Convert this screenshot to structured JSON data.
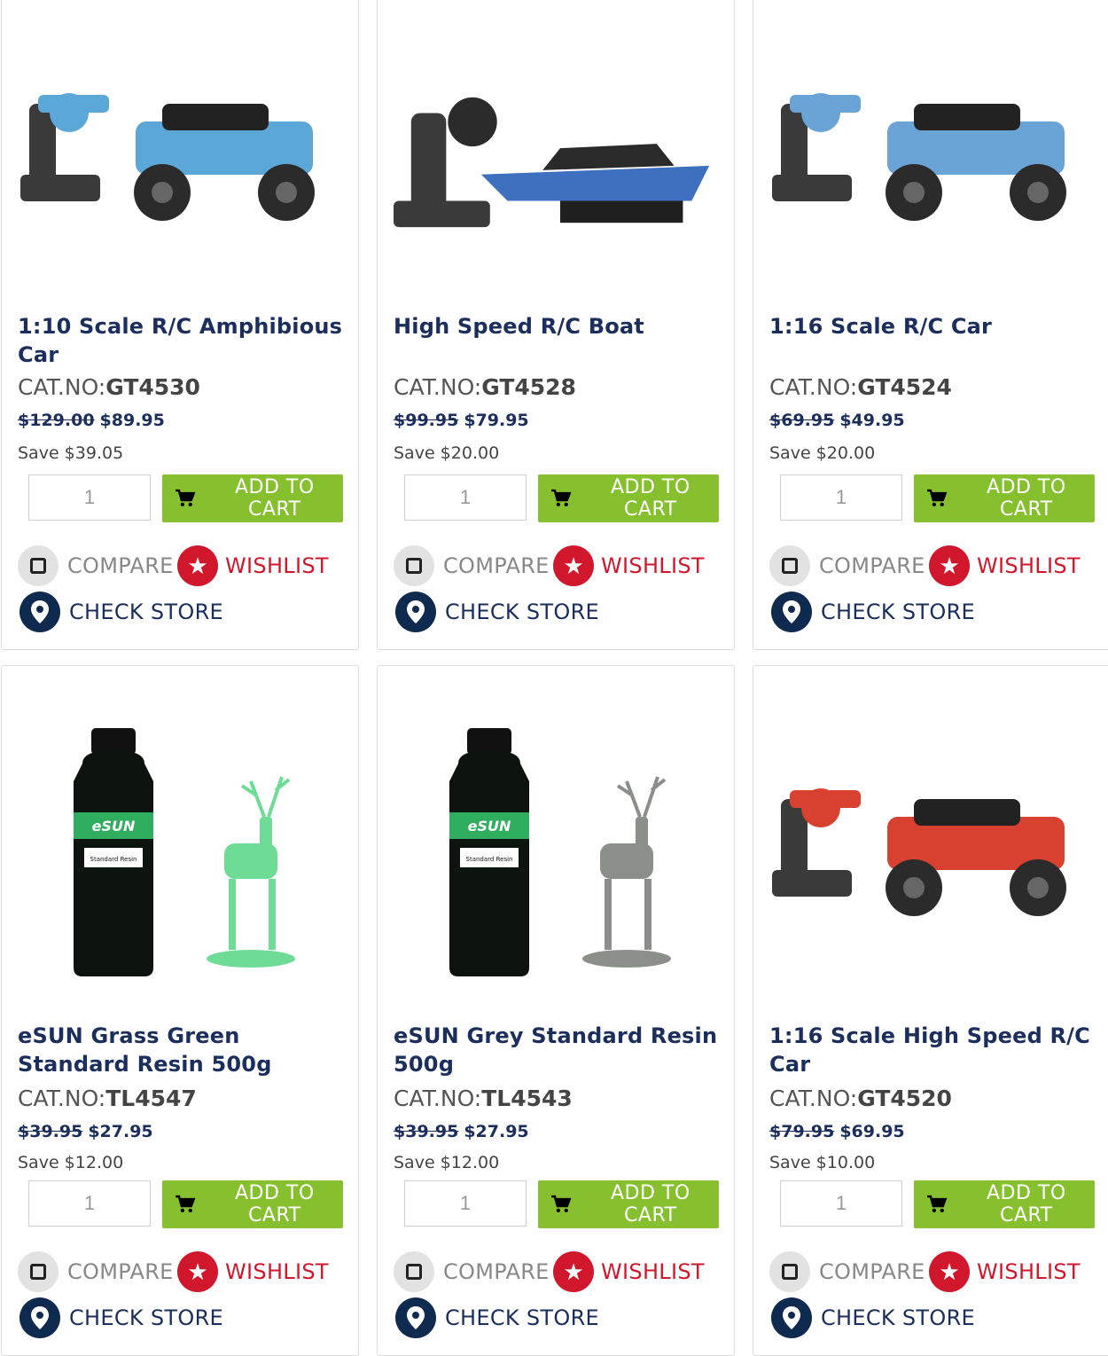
{
  "products": [
    {
      "title": "1:10 Scale R/C Amphibious Car",
      "catno_label": "CAT.NO:",
      "catno": "GT4530",
      "old_price": "$129.00",
      "price": "$89.95",
      "save": "Save $39.05",
      "qty": "1",
      "image": "rc-amphibious-car-blue",
      "accent": "#5aa7d8"
    },
    {
      "title": "High Speed R/C Boat",
      "catno_label": "CAT.NO:",
      "catno": "GT4528",
      "old_price": "$99.95",
      "price": "$79.95",
      "save": "Save $20.00",
      "qty": "1",
      "image": "rc-boat-blue",
      "accent": "#3f6fbf"
    },
    {
      "title": "1:16 Scale R/C Car",
      "catno_label": "CAT.NO:",
      "catno": "GT4524",
      "old_price": "$69.95",
      "price": "$49.95",
      "save": "Save $20.00",
      "qty": "1",
      "image": "rc-car-blue",
      "accent": "#6aa3d6"
    },
    {
      "title": "eSUN Grass Green Standard Resin 500g",
      "catno_label": "CAT.NO:",
      "catno": "TL4547",
      "old_price": "$39.95",
      "price": "$27.95",
      "save": "Save $12.00",
      "qty": "1",
      "image": "resin-bottle-green-deer",
      "accent": "#6fdc96"
    },
    {
      "title": "eSUN Grey Standard Resin 500g",
      "catno_label": "CAT.NO:",
      "catno": "TL4543",
      "old_price": "$39.95",
      "price": "$27.95",
      "save": "Save $12.00",
      "qty": "1",
      "image": "resin-bottle-grey-deer",
      "accent": "#8a8f8a"
    },
    {
      "title": "1:16 Scale High Speed R/C Car",
      "catno_label": "CAT.NO:",
      "catno": "GT4520",
      "old_price": "$79.95",
      "price": "$69.95",
      "save": "Save $10.00",
      "qty": "1",
      "image": "rc-car-red",
      "accent": "#d8402f"
    }
  ],
  "labels": {
    "add_to_cart": "ADD TO CART",
    "compare": "COMPARE",
    "wishlist": "WISHLIST",
    "check_store": "CHECK STORE"
  },
  "bottle_brand": "eSUN",
  "bottle_label": "Standard Resin",
  "colors": {
    "title": "#1b2e5c",
    "cart_button": "#86c02e",
    "wishlist": "#d0172c",
    "check_store_icon": "#0f2a4f"
  }
}
